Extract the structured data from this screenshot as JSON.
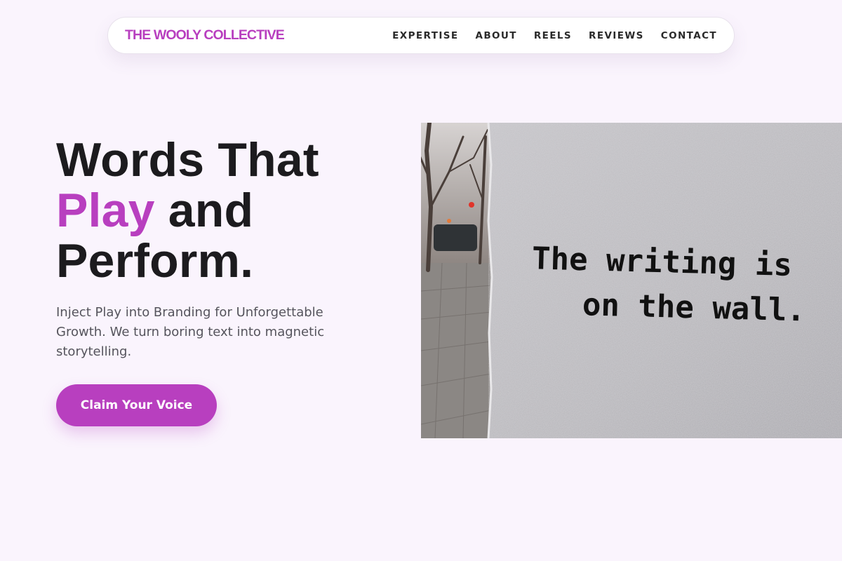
{
  "brand": "THE WOOLY COLLECTIVE",
  "nav": {
    "items": [
      {
        "label": "EXPERTISE",
        "name": "nav-expertise"
      },
      {
        "label": "ABOUT",
        "name": "nav-about"
      },
      {
        "label": "REELS",
        "name": "nav-reels"
      },
      {
        "label": "REVIEWS",
        "name": "nav-reviews"
      },
      {
        "label": "CONTACT",
        "name": "nav-contact"
      }
    ]
  },
  "hero": {
    "title_line1": "Words That",
    "title_accent": "Play",
    "title_line2_rest": " and",
    "title_line3": "Perform.",
    "subtitle": "Inject Play into Branding for Unforgettable Growth. We turn boring text into magnetic storytelling.",
    "cta_label": "Claim Your Voice",
    "image_text_line1": "The writing is",
    "image_text_line2": "on the wall."
  },
  "colors": {
    "accent": "#b83fbf",
    "background": "#faf4fd",
    "heading": "#1c1b1e",
    "body_text": "#55545c"
  }
}
